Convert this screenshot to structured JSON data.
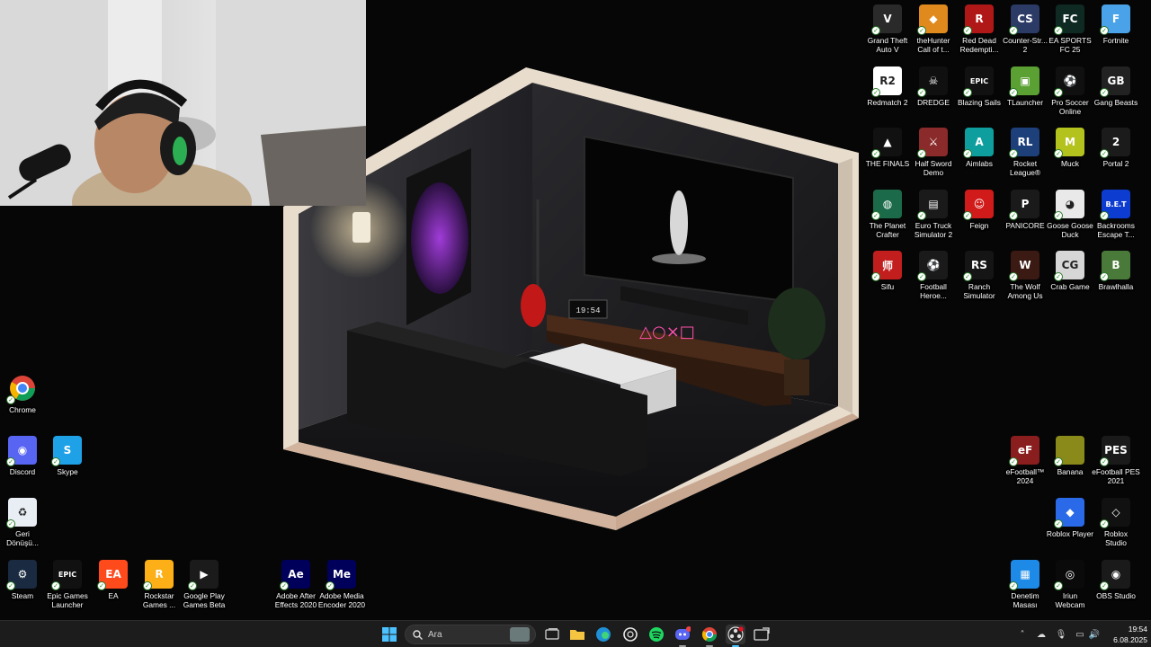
{
  "taskbar": {
    "search_placeholder": "Ara",
    "clock_time": "19:54",
    "clock_date": "6.08.2025",
    "pinned": [
      "windows-start",
      "search",
      "task-view",
      "file-explorer",
      "edge",
      "chatgpt",
      "spotify",
      "discord",
      "chrome",
      "obs",
      "app"
    ]
  },
  "wallpaper": {
    "room_clock": "19:54",
    "shelf_symbols": "△○×□"
  },
  "desktop_left": [
    {
      "id": "chrome",
      "label": "Chrome",
      "color": "#ffffff",
      "glyph": ""
    },
    {
      "id": "discord",
      "label": "Discord",
      "color": "#5865f2",
      "glyph": "◉"
    },
    {
      "id": "skype",
      "label": "Skype",
      "color": "#1ea1e6",
      "glyph": "S"
    },
    {
      "id": "recycle",
      "label": "Geri\nDönüşü...",
      "color": "#e8eef3",
      "glyph": "♻"
    },
    {
      "id": "steam",
      "label": "Steam",
      "color": "#1a2a40",
      "glyph": "⚙"
    },
    {
      "id": "epic",
      "label": "Epic Games\nLauncher",
      "color": "#111111",
      "glyph": "EPIC"
    },
    {
      "id": "ea",
      "label": "EA",
      "color": "#ff4a1c",
      "glyph": "EA"
    },
    {
      "id": "rockstar",
      "label": "Rockstar\nGames ...",
      "color": "#fcaf17",
      "glyph": "R"
    },
    {
      "id": "gplay",
      "label": "Google Play\nGames Beta",
      "color": "#1b1b1b",
      "glyph": "▶"
    },
    {
      "id": "ae",
      "label": "Adobe After\nEffects 2020",
      "color": "#00005b",
      "glyph": "Ae"
    },
    {
      "id": "me",
      "label": "Adobe Media\nEncoder 2020",
      "color": "#00005b",
      "glyph": "Me"
    }
  ],
  "desktop_right": [
    {
      "id": "gta",
      "label": "Grand Theft\nAuto V",
      "color": "#2a2a2a",
      "glyph": "V"
    },
    {
      "id": "thehunter",
      "label": "theHunter\nCall of t...",
      "color": "#e08a1e",
      "glyph": "◆"
    },
    {
      "id": "rdr",
      "label": "Red Dead\nRedempti...",
      "color": "#b01717",
      "glyph": "R"
    },
    {
      "id": "cs2",
      "label": "Counter-Str...\n2",
      "color": "#2c3a66",
      "glyph": "CS"
    },
    {
      "id": "fc25",
      "label": "EA SPORTS\nFC 25",
      "color": "#0e2a23",
      "glyph": "FC"
    },
    {
      "id": "fortnite",
      "label": "Fortnite",
      "color": "#4aa3e8",
      "glyph": "F"
    },
    {
      "id": "rdr2",
      "label": "Redmatch 2",
      "color": "#ffffff",
      "glyph": "R2"
    },
    {
      "id": "dredge",
      "label": "DREDGE",
      "color": "#101010",
      "glyph": "☠"
    },
    {
      "id": "blazing",
      "label": "Blazing Sails",
      "color": "#111111",
      "glyph": "EPIC"
    },
    {
      "id": "tlauncher",
      "label": "TLauncher",
      "color": "#5aa032",
      "glyph": "▣"
    },
    {
      "id": "prosoccer",
      "label": "Pro Soccer\nOnline",
      "color": "#101010",
      "glyph": "⚽"
    },
    {
      "id": "gangbeasts",
      "label": "Gang Beasts",
      "color": "#222222",
      "glyph": "GB"
    },
    {
      "id": "thefinals",
      "label": "THE FINALS",
      "color": "#111111",
      "glyph": "▲"
    },
    {
      "id": "halfsword",
      "label": "Half Sword\nDemo",
      "color": "#8a2a2a",
      "glyph": "⚔"
    },
    {
      "id": "aimlabs",
      "label": "Aimlabs",
      "color": "#0f9e9e",
      "glyph": "A"
    },
    {
      "id": "rocketleague",
      "label": "Rocket\nLeague®",
      "color": "#1d3f7a",
      "glyph": "RL"
    },
    {
      "id": "muck",
      "label": "Muck",
      "color": "#b4c21e",
      "glyph": "M"
    },
    {
      "id": "portal2",
      "label": "Portal 2",
      "color": "#1b1b1b",
      "glyph": "2"
    },
    {
      "id": "planetcrafter",
      "label": "The Planet\nCrafter",
      "color": "#1b6b4a",
      "glyph": "◍"
    },
    {
      "id": "ets2",
      "label": "Euro Truck\nSimulator 2",
      "color": "#1a1a1a",
      "glyph": "▤"
    },
    {
      "id": "feign",
      "label": "Feign",
      "color": "#d11a1a",
      "glyph": "☺"
    },
    {
      "id": "panicore",
      "label": "PANICORE",
      "color": "#1a1a1a",
      "glyph": "P"
    },
    {
      "id": "goose",
      "label": "Goose Goose\nDuck",
      "color": "#e9e9e9",
      "glyph": "◕"
    },
    {
      "id": "backrooms",
      "label": "Backrooms\nEscape T...",
      "color": "#0d3cd1",
      "glyph": "B.E.T"
    },
    {
      "id": "sifu",
      "label": "Sifu",
      "color": "#c21e1e",
      "glyph": "师"
    },
    {
      "id": "footballheroes",
      "label": "Football\nHeroe...",
      "color": "#1a1a1a",
      "glyph": "⚽"
    },
    {
      "id": "ranchsim",
      "label": "Ranch\nSimulator",
      "color": "#151515",
      "glyph": "RS"
    },
    {
      "id": "wolfamongus",
      "label": "The Wolf\nAmong Us",
      "color": "#3a1a12",
      "glyph": "W"
    },
    {
      "id": "crabgame",
      "label": "Crab Game",
      "color": "#d6d6d6",
      "glyph": "CG"
    },
    {
      "id": "brawlhalla",
      "label": "Brawlhalla",
      "color": "#4a7a3a",
      "glyph": "B"
    },
    {
      "id": "efootball2024",
      "label": "eFootball™\n2024",
      "color": "#8a1e1e",
      "glyph": "eF"
    },
    {
      "id": "banana",
      "label": "Banana",
      "color": "#8a8a1a",
      "glyph": ""
    },
    {
      "id": "efootballpes",
      "label": "eFootball PES\n2021",
      "color": "#1a1a1a",
      "glyph": "PES"
    },
    {
      "id": "roblox",
      "label": "Roblox Player",
      "color": "#2a6ae8",
      "glyph": "◆"
    },
    {
      "id": "robloxstudio",
      "label": "Roblox\nStudio",
      "color": "#111111",
      "glyph": "◇"
    },
    {
      "id": "denetim",
      "label": "Denetim\nMasası",
      "color": "#1e8ae8",
      "glyph": "▦"
    },
    {
      "id": "iriun",
      "label": "Iriun\nWebcam",
      "color": "#0a0a0a",
      "glyph": "◎"
    },
    {
      "id": "obs",
      "label": "OBS Studio",
      "color": "#1a1a1a",
      "glyph": "◉"
    }
  ]
}
